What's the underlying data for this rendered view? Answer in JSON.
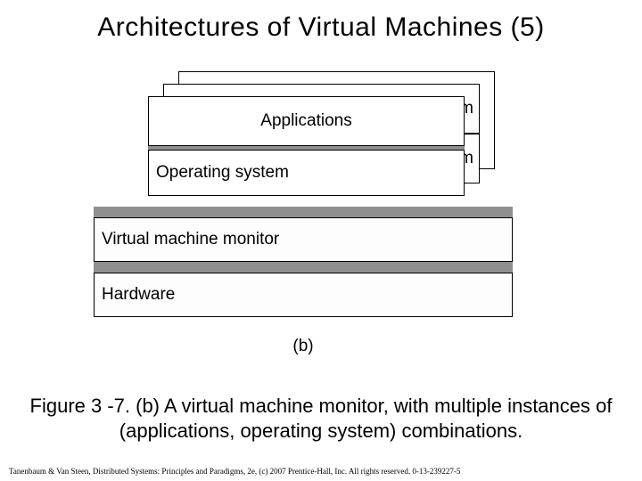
{
  "title": "Architectures of Virtual Machines (5)",
  "diagram": {
    "stack_back_m1": "m",
    "stack_back_m2": "m",
    "applications_label": "Applications",
    "os_label": "Operating system",
    "vmm_label": "Virtual machine monitor",
    "hardware_label": "Hardware",
    "sub_label": "(b)"
  },
  "caption": "Figure 3 -7. (b) A virtual machine monitor, with multiple instances of (applications, operating system) combinations.",
  "footer": "Tanenbaum & Van Steen, Distributed Systems: Principles and Paradigms, 2e, (c) 2007 Prentice-Hall, Inc. All rights reserved. 0-13-239227-5"
}
